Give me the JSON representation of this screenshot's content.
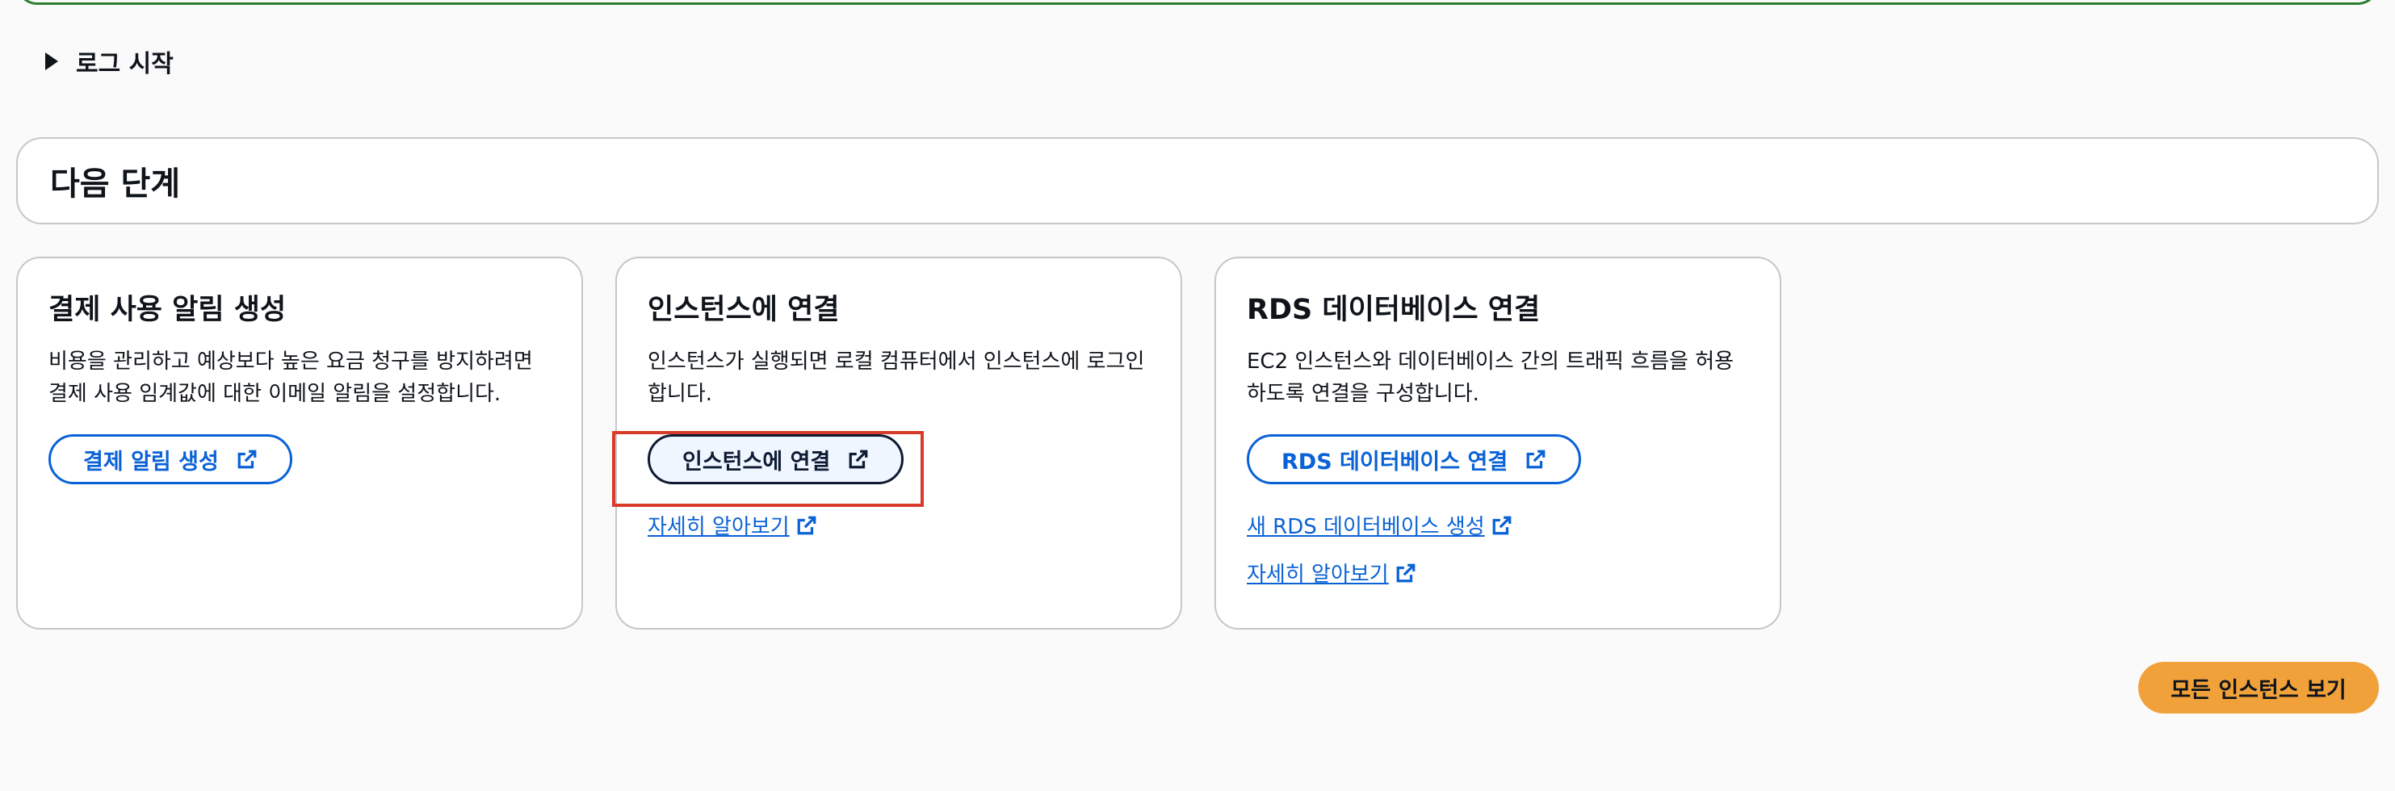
{
  "log": {
    "label": "로그 시작"
  },
  "next_steps": {
    "title": "다음 단계"
  },
  "cards": [
    {
      "title": "결제 사용 알림 생성",
      "desc_line1": "비용을 관리하고 예상보다 높은 요금 청구를 방지하려면",
      "desc_line2": "결제 사용 임계값에 대한 이메일 알림을 설정합니다.",
      "button_label": "결제 알림 생성"
    },
    {
      "title": "인스턴스에 연결",
      "desc_line1": "인스턴스가 실행되면 로컬 컴퓨터에서 인스턴스에 로그인",
      "desc_line2": "합니다.",
      "button_label": "인스턴스에 연결",
      "link1": "자세히 알아보기"
    },
    {
      "title": "RDS 데이터베이스 연결",
      "desc_line1": "EC2 인스턴스와 데이터베이스 간의 트래픽 흐름을 허용",
      "desc_line2": "하도록 연결을 구성합니다.",
      "button_label": "RDS 데이터베이스 연결",
      "link1": "새 RDS 데이터베이스 생성",
      "link2": "자세히 알아보기"
    }
  ],
  "footer": {
    "view_all_label": "모든 인스턴스 보기"
  },
  "colors": {
    "accent": "#0a62d6",
    "success_bar": "#2e7d32",
    "highlight": "#d93b2b",
    "primary_button": "#f1a13a"
  },
  "icons": {
    "external": "external-link-icon",
    "expand": "caret-right-icon"
  }
}
